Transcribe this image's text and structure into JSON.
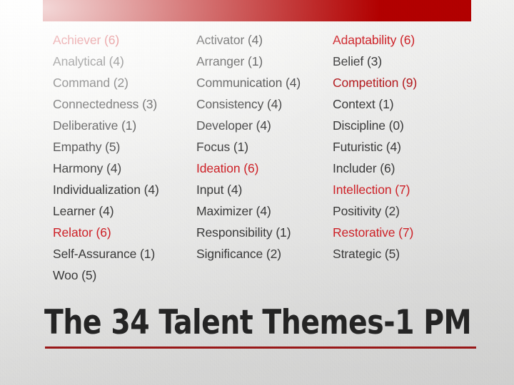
{
  "slide": {
    "title": "The 34 Talent Themes-1 PM",
    "accent_bar_color": "#b30000",
    "title_rule_color": "#9e1a1a",
    "highlight_color": "#cf2127",
    "text_color": "#3b3b3b",
    "background_color": "#e9e9e8"
  },
  "columns": [
    {
      "name": "column-1",
      "items": [
        {
          "label": "Achiever (6)",
          "theme": "Achiever",
          "count": 6,
          "highlighted": true
        },
        {
          "label": "Analytical (4)",
          "theme": "Analytical",
          "count": 4,
          "highlighted": false
        },
        {
          "label": "Command (2)",
          "theme": "Command",
          "count": 2,
          "highlighted": false
        },
        {
          "label": "Connectedness (3)",
          "theme": "Connectedness",
          "count": 3,
          "highlighted": false
        },
        {
          "label": "Deliberative (1)",
          "theme": "Deliberative",
          "count": 1,
          "highlighted": false
        },
        {
          "label": "Empathy (5)",
          "theme": "Empathy",
          "count": 5,
          "highlighted": false
        },
        {
          "label": "Harmony (4)",
          "theme": "Harmony",
          "count": 4,
          "highlighted": false
        },
        {
          "label": "Individualization (4)",
          "theme": "Individualization",
          "count": 4,
          "highlighted": false
        },
        {
          "label": "Learner (4)",
          "theme": "Learner",
          "count": 4,
          "highlighted": false
        },
        {
          "label": "Relator (6)",
          "theme": "Relator",
          "count": 6,
          "highlighted": true
        },
        {
          "label": "Self-Assurance (1)",
          "theme": "Self-Assurance",
          "count": 1,
          "highlighted": false
        },
        {
          "label": "Woo (5)",
          "theme": "Woo",
          "count": 5,
          "highlighted": false
        }
      ]
    },
    {
      "name": "column-2",
      "items": [
        {
          "label": "Activator (4)",
          "theme": "Activator",
          "count": 4,
          "highlighted": false
        },
        {
          "label": "Arranger (1)",
          "theme": "Arranger",
          "count": 1,
          "highlighted": false
        },
        {
          "label": "Communication (4)",
          "theme": "Communication",
          "count": 4,
          "highlighted": false
        },
        {
          "label": "Consistency (4)",
          "theme": "Consistency",
          "count": 4,
          "highlighted": false
        },
        {
          "label": "Developer (4)",
          "theme": "Developer",
          "count": 4,
          "highlighted": false
        },
        {
          "label": "Focus (1)",
          "theme": "Focus",
          "count": 1,
          "highlighted": false
        },
        {
          "label": "Ideation (6)",
          "theme": "Ideation",
          "count": 6,
          "highlighted": true
        },
        {
          "label": "Input (4)",
          "theme": "Input",
          "count": 4,
          "highlighted": false
        },
        {
          "label": "Maximizer (4)",
          "theme": "Maximizer",
          "count": 4,
          "highlighted": false
        },
        {
          "label": "Responsibility (1)",
          "theme": "Responsibility",
          "count": 1,
          "highlighted": false
        },
        {
          "label": "Significance (2)",
          "theme": "Significance",
          "count": 2,
          "highlighted": false
        }
      ]
    },
    {
      "name": "column-3",
      "items": [
        {
          "label": "Adaptability (6)",
          "theme": "Adaptability",
          "count": 6,
          "highlighted": true
        },
        {
          "label": "Belief (3)",
          "theme": "Belief",
          "count": 3,
          "highlighted": false
        },
        {
          "label": "Competition (9)",
          "theme": "Competition",
          "count": 9,
          "highlighted": true
        },
        {
          "label": "Context (1)",
          "theme": "Context",
          "count": 1,
          "highlighted": false
        },
        {
          "label": "Discipline (0)",
          "theme": "Discipline",
          "count": 0,
          "highlighted": false
        },
        {
          "label": "Futuristic (4)",
          "theme": "Futuristic",
          "count": 4,
          "highlighted": false
        },
        {
          "label": "Includer (6)",
          "theme": "Includer",
          "count": 6,
          "highlighted": false
        },
        {
          "label": "Intellection (7)",
          "theme": "Intellection",
          "count": 7,
          "highlighted": true
        },
        {
          "label": "Positivity (2)",
          "theme": "Positivity",
          "count": 2,
          "highlighted": false
        },
        {
          "label": "Restorative (7)",
          "theme": "Restorative",
          "count": 7,
          "highlighted": true
        },
        {
          "label": "Strategic (5)",
          "theme": "Strategic",
          "count": 5,
          "highlighted": false
        }
      ]
    }
  ]
}
